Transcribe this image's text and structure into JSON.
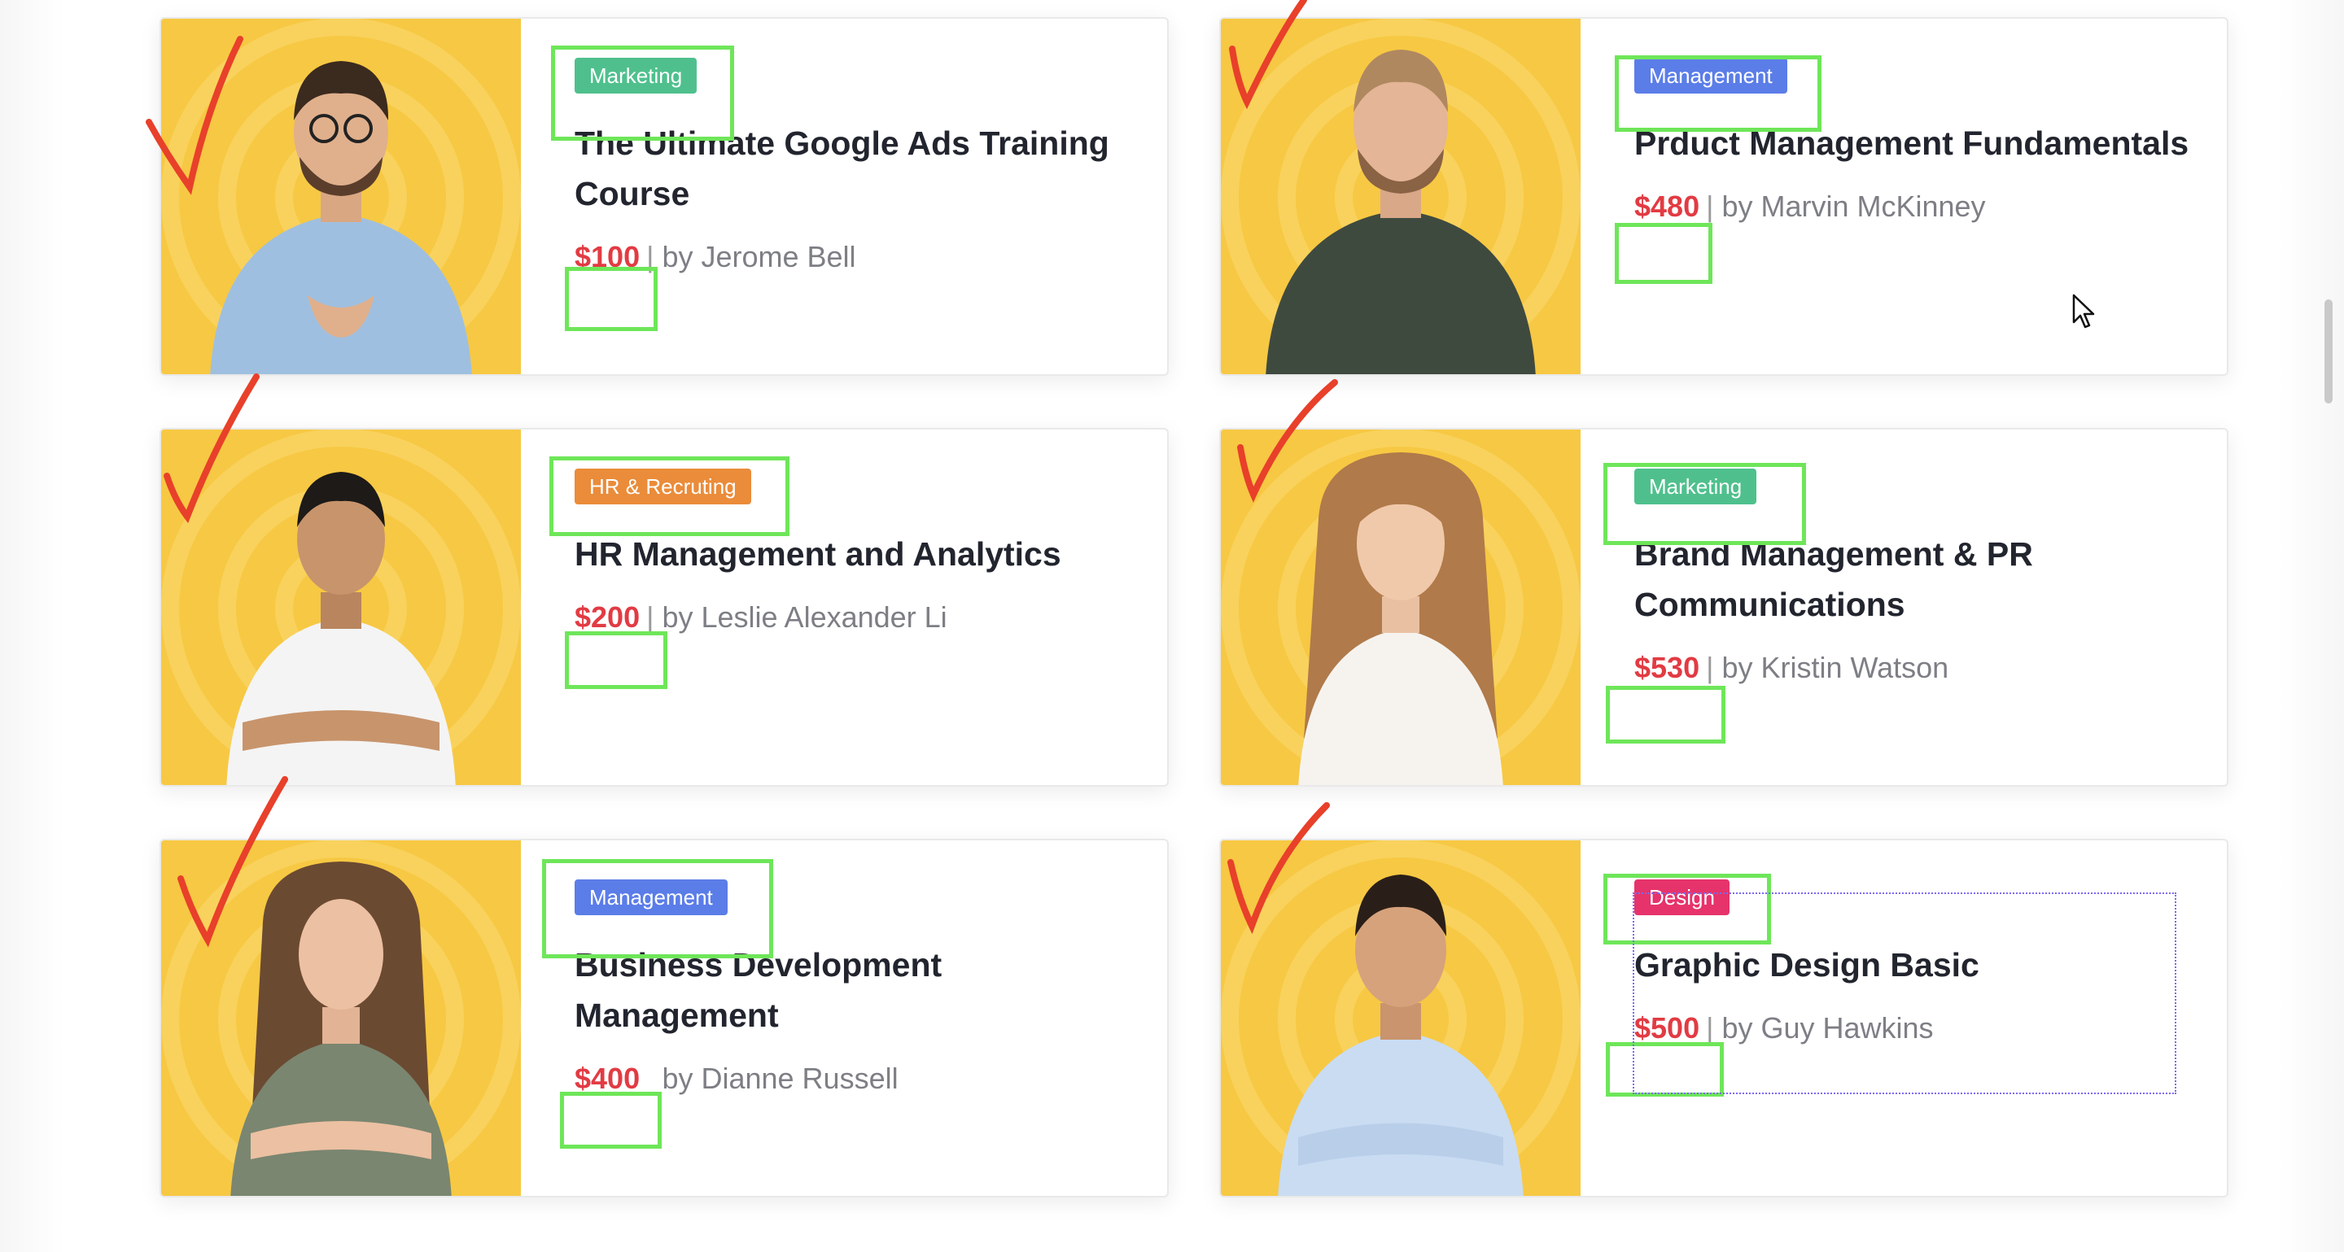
{
  "courses": [
    {
      "tag": "Marketing",
      "tag_color": "#4fc08d",
      "title": "The Ultimate Google Ads Training Course",
      "price": "$100",
      "author": "by Jerome Bell"
    },
    {
      "tag": "Management",
      "tag_color": "#5b7de8",
      "title": "Prduct Management Fundamentals",
      "price": "$480",
      "author": "by Marvin McKinney"
    },
    {
      "tag": "HR & Recruting",
      "tag_color": "#ea8c3a",
      "title": "HR  Management and Analytics",
      "price": "$200",
      "author": "by Leslie Alexander Li"
    },
    {
      "tag": "Marketing",
      "tag_color": "#4fc08d",
      "title": "Brand Management & PR Communications",
      "price": "$530",
      "author": "by Kristin Watson"
    },
    {
      "tag": "Management",
      "tag_color": "#5b7de8",
      "title": "Business Development Management",
      "price": "$400",
      "author": "by Dianne Russell"
    },
    {
      "tag": "Design",
      "tag_color": "#e6336b",
      "title": "Graphic Design Basic",
      "price": "$500",
      "author": "by Guy Hawkins"
    }
  ],
  "colors": {
    "photo_background": "#f7c843",
    "price": "#e23b43",
    "annotation_highlight": "#6ee659",
    "annotation_check": "#e8402a"
  },
  "icons": [
    "checkmark-annotation-icon",
    "mouse-cursor-icon"
  ]
}
